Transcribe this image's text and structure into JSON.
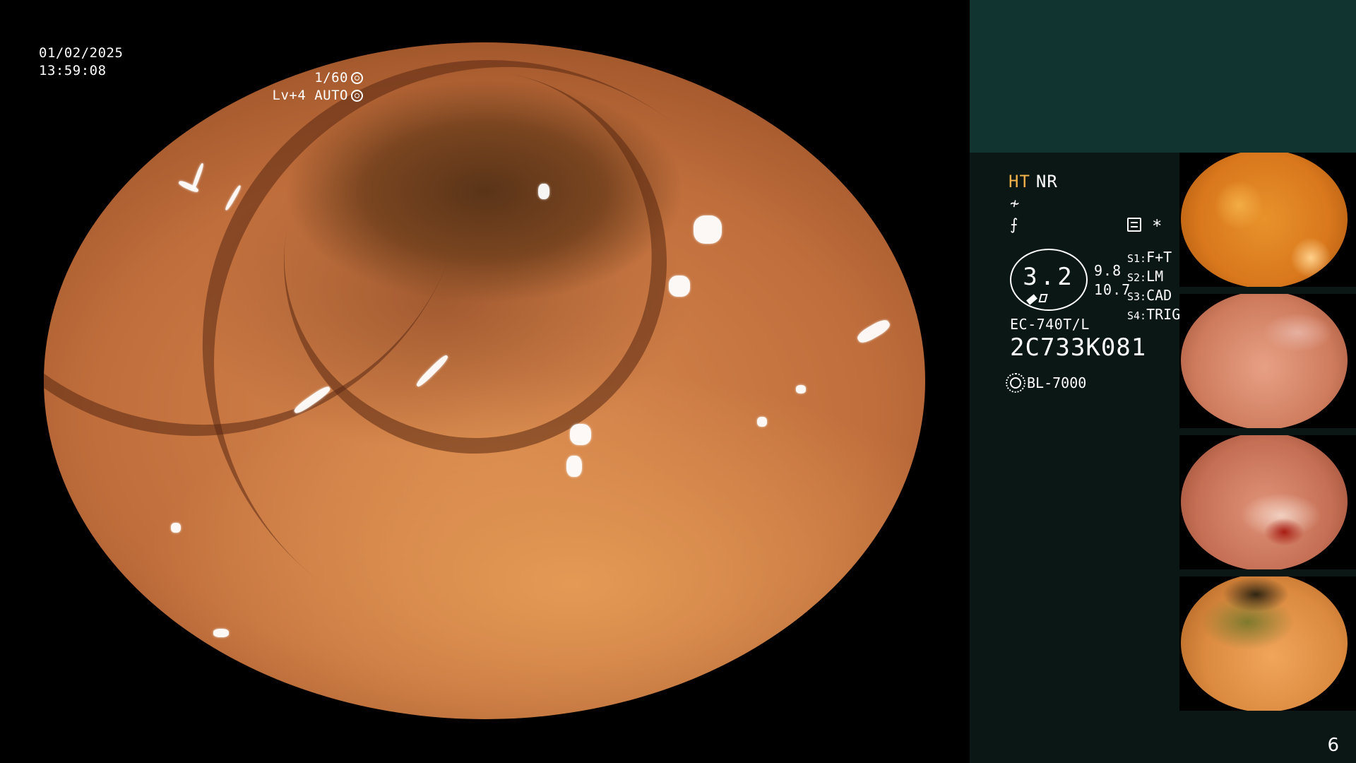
{
  "overlay": {
    "date": "01/02/2025",
    "time": "13:59:08",
    "shutter": "1/60",
    "level": "Lv+4 AUTO"
  },
  "info": {
    "mode_ht": "HT",
    "mode_nr": "NR",
    "dial_value": "3.2",
    "dial_num_top": "9.8",
    "dial_num_bottom": "10.7",
    "scenes": [
      {
        "key": "S1:",
        "value": "F+T"
      },
      {
        "key": "S2:",
        "value": "LM"
      },
      {
        "key": "S3:",
        "value": "CAD"
      },
      {
        "key": "S4:",
        "value": "TRIG"
      }
    ],
    "scope_model": "EC-740T/L",
    "scope_serial": "2C733K081",
    "light_source": "BL-7000"
  },
  "page_number": "6",
  "colors": {
    "panel_top": "#123430",
    "panel_bottom": "#0a1714",
    "ht_accent": "#f2b14a"
  },
  "icons": [
    "shutter-icon",
    "auto-exposure-icon",
    "tilde-icon",
    "slash-icon",
    "grid-icon",
    "asterisk-icon",
    "lamp-icon"
  ]
}
